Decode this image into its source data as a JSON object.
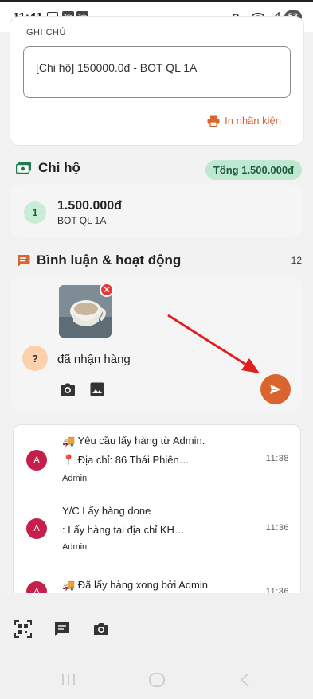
{
  "statusbar": {
    "time": "11:41",
    "zalo_1": "Zalo",
    "zalo_2": "Zalo",
    "battery": "53"
  },
  "note": {
    "label": "GHI CHÚ",
    "value": "[Chi hộ] 150000.0đ - BOT QL 1A",
    "print_label": "In nhãn kiện"
  },
  "cod": {
    "title": "Chi hộ",
    "total": "Tổng 1.500.000đ",
    "items": [
      {
        "index": "1",
        "amount": "1.500.000đ",
        "name": "BOT QL 1A"
      }
    ]
  },
  "comments": {
    "title": "Bình luận & hoạt động",
    "count": "12",
    "composer": {
      "avatar": "?",
      "text": "đã nhận hàng"
    }
  },
  "activity": [
    {
      "avatar": "A",
      "line1": "🚚 Yêu cầu lấy hàng từ Admin.",
      "line2": "📍 Địa chỉ: 86 Thái Phiên…",
      "author": "Admin",
      "time": "11:38"
    },
    {
      "avatar": "A",
      "line1": "Y/C Lấy hàng done",
      "line2": "      : Lấy hàng tại địa chỉ KH…",
      "author": "Admin",
      "time": "11:36"
    },
    {
      "avatar": "A",
      "line1": "🚚 Đã lấy hàng xong bởi Admin",
      "line2": "",
      "author": "",
      "time": "11:36"
    }
  ],
  "colors": {
    "accent": "#d9642d",
    "green_pill": "#bfe8d0",
    "avatar_red": "#c51f4c",
    "annotation_arrow": "#e02020"
  },
  "icons": {
    "print": "printer-icon",
    "cod": "cash-icon",
    "comments": "comment-icon",
    "camera": "camera-icon",
    "gallery": "image-icon",
    "send": "send-icon",
    "qr": "qr-scan-icon",
    "chat": "chat-icon"
  }
}
